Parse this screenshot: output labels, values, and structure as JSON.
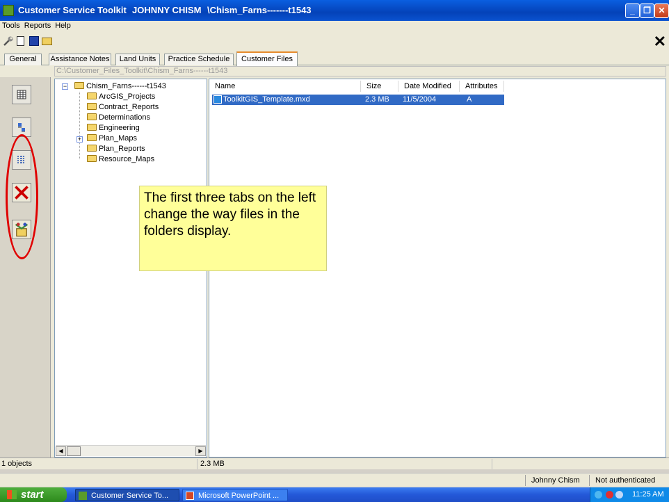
{
  "window": {
    "app_title": "Customer Service Toolkit",
    "user": "JOHNNY CHISM",
    "path_title": "\\Chism_Farns-------t1543",
    "minimize": "_",
    "maximize": "❐",
    "close": "✕"
  },
  "menu": {
    "items": [
      "Tools",
      "Reports",
      "Help"
    ]
  },
  "toolbar": {
    "close_glyph": "✕"
  },
  "tabs": [
    {
      "label": "General"
    },
    {
      "label": "Assistance Notes"
    },
    {
      "label": "Land Units"
    },
    {
      "label": "Practice Schedule"
    },
    {
      "label": "Customer Files",
      "active": true
    }
  ],
  "path": "C:\\Customer_Files_Toolkit\\Chism_Farns------t1543",
  "tree": {
    "root": "Chism_Farns------t1543",
    "root_expander": "−",
    "children": [
      {
        "label": "ArcGIS_Projects"
      },
      {
        "label": "Contract_Reports"
      },
      {
        "label": "Determinations"
      },
      {
        "label": "Engineering"
      },
      {
        "label": "Plan_Maps",
        "expander": "+"
      },
      {
        "label": "Plan_Reports"
      },
      {
        "label": "Resource_Maps"
      }
    ],
    "scroll_left": "◀",
    "scroll_right": "▶"
  },
  "filelist": {
    "columns": [
      "Name",
      "Size",
      "Date Modified",
      "Attributes"
    ],
    "rows": [
      {
        "name": "ToolkitGIS_Template.mxd",
        "size": "2.3 MB",
        "date": "11/5/2004",
        "attr": "A"
      }
    ]
  },
  "callout": {
    "text": "The first three tabs on the left change the way files in the folders display."
  },
  "status": {
    "objects": "1 objects",
    "size": "2.3 MB",
    "user": "Johnny Chism",
    "auth": "Not authenticated"
  },
  "taskbar": {
    "start": "start",
    "items": [
      "Customer Service To...",
      "Microsoft PowerPoint ..."
    ],
    "clock": "11:25 AM"
  },
  "colors": {
    "titlebar": "#0a52d0",
    "selection": "#316ac5",
    "callout": "#ffff99",
    "highlight_ring": "#e00000"
  }
}
